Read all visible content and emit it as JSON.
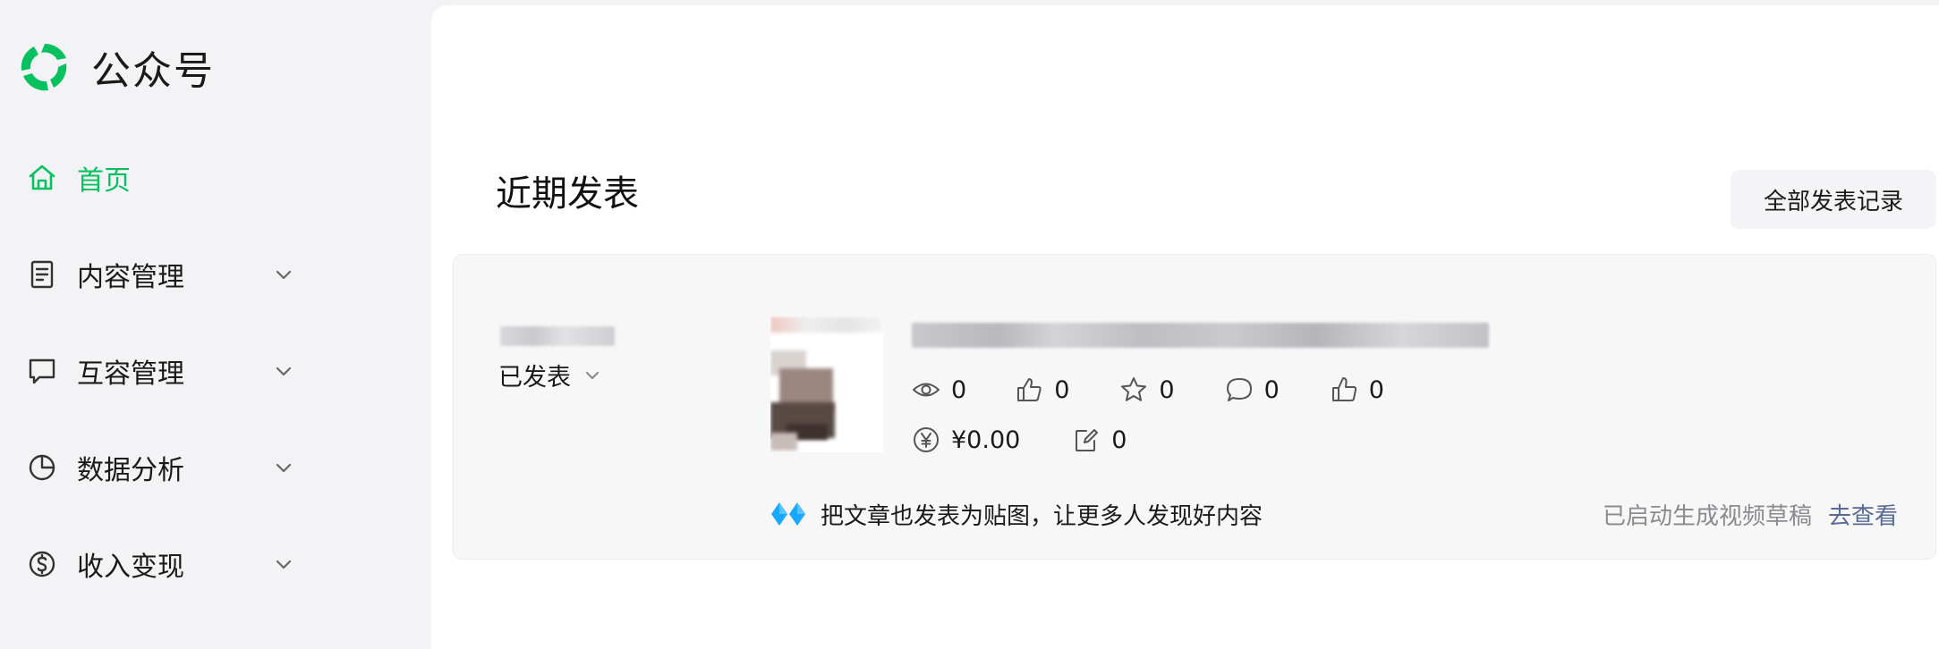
{
  "brand": {
    "name": "公众号",
    "logo_icon": "wechat-official-account-logo",
    "accent": "#07c160"
  },
  "sidebar": {
    "items": [
      {
        "label": "首页",
        "icon": "home-icon",
        "active": true,
        "expandable": false
      },
      {
        "label": "内容管理",
        "icon": "document-icon",
        "active": false,
        "expandable": true
      },
      {
        "label": "互容管理",
        "icon": "message-icon",
        "active": false,
        "expandable": true
      },
      {
        "label": "数据分析",
        "icon": "pie-chart-icon",
        "active": false,
        "expandable": true
      },
      {
        "label": "收入变现",
        "icon": "dollar-circle-icon",
        "active": false,
        "expandable": true
      }
    ]
  },
  "main": {
    "title": "近期发表",
    "all_records_label": "全部发表记录",
    "post": {
      "status_label": "已发表",
      "stats": {
        "reads": "0",
        "shares": "0",
        "favorites": "0",
        "comments": "0",
        "likes": "0",
        "income": "¥0.00",
        "edits": "0"
      },
      "promo_text": "把文章也发表为贴图，让更多人发现好内容",
      "video_status": "已启动生成视频草稿",
      "go_view_label": "去查看"
    }
  },
  "colors": {
    "green": "#07c160",
    "link": "#576b95",
    "muted": "#8a8a8f",
    "promo_blue": "#1aa7ff"
  }
}
